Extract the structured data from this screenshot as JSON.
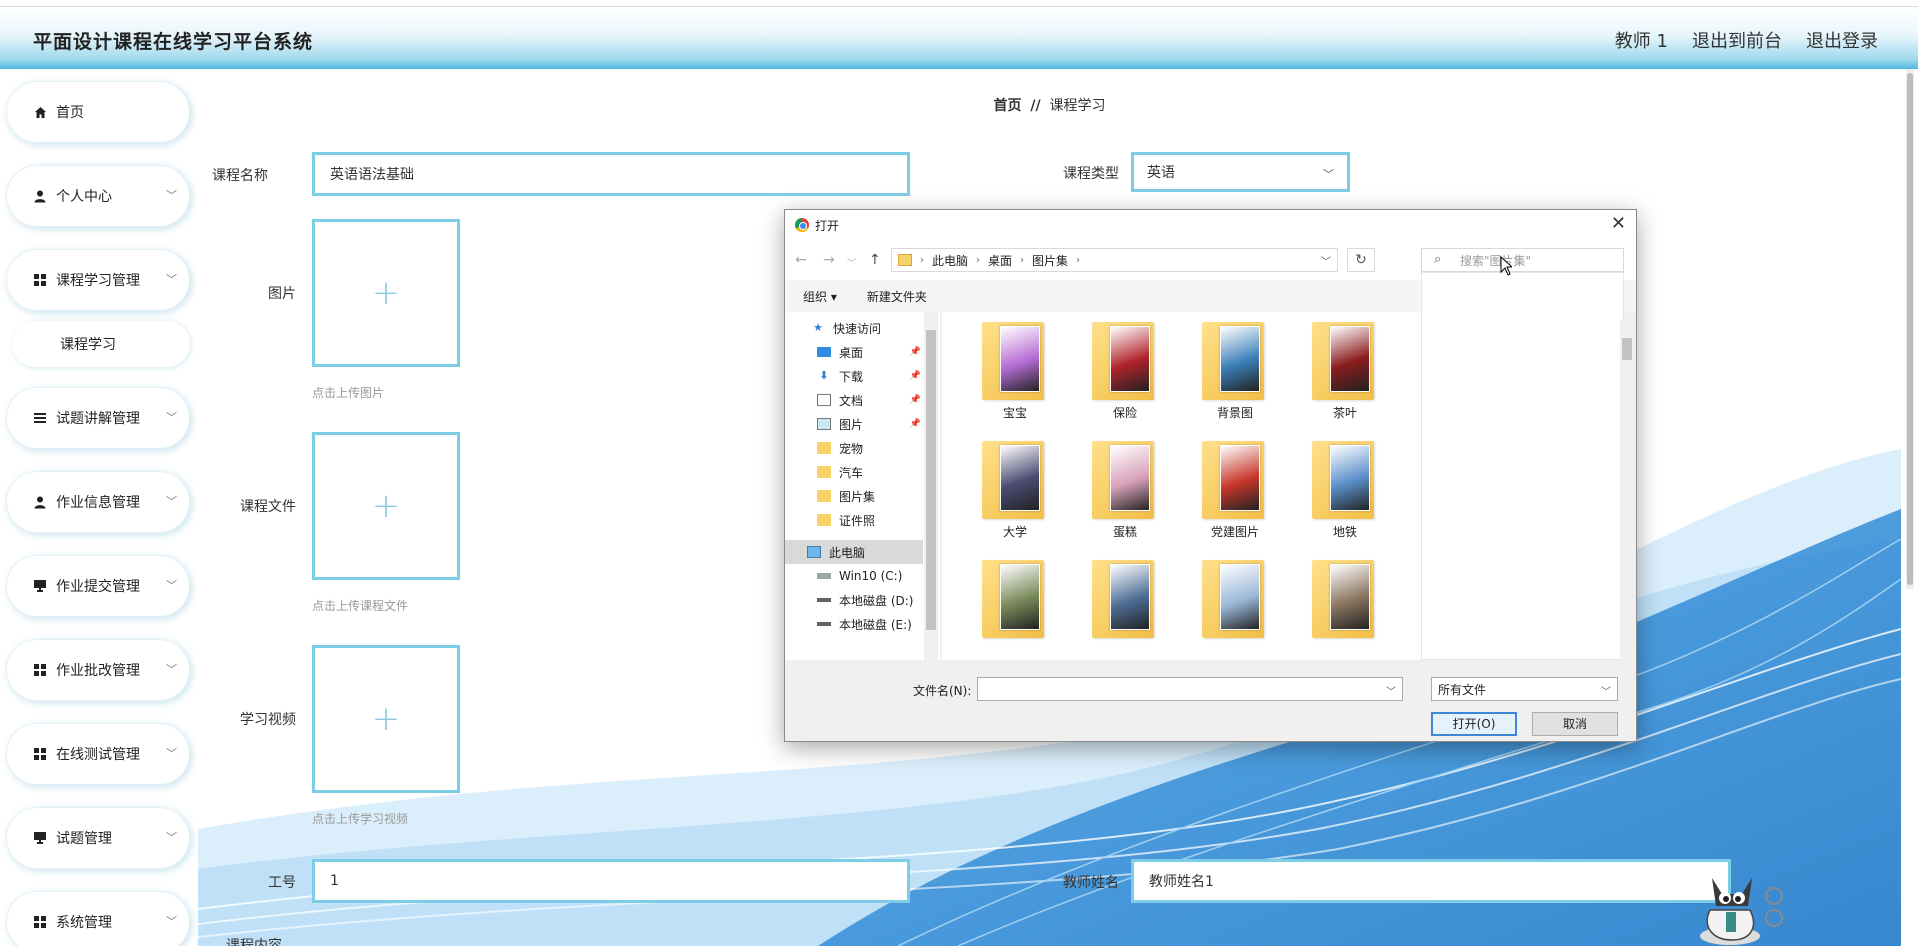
{
  "header": {
    "title": "平面设计课程在线学习平台系统",
    "user": "教师 1",
    "front_link": "退出到前台",
    "logout": "退出登录"
  },
  "sidebar": {
    "items": [
      {
        "label": "首页",
        "icon": "home-icon"
      },
      {
        "label": "个人中心",
        "icon": "person-icon"
      },
      {
        "label": "课程学习管理",
        "icon": "grid-icon"
      },
      {
        "label": "课程学习",
        "icon": ""
      },
      {
        "label": "试题讲解管理",
        "icon": "list-icon"
      },
      {
        "label": "作业信息管理",
        "icon": "person-icon"
      },
      {
        "label": "作业提交管理",
        "icon": "monitor-icon"
      },
      {
        "label": "作业批改管理",
        "icon": "grid-icon"
      },
      {
        "label": "在线测试管理",
        "icon": "grid-icon"
      },
      {
        "label": "试题管理",
        "icon": "monitor-icon"
      },
      {
        "label": "系统管理",
        "icon": "grid-icon"
      }
    ]
  },
  "breadcrumb": {
    "home": "首页",
    "sep": "//",
    "current": "课程学习"
  },
  "form": {
    "course_name_label": "课程名称",
    "course_name_value": "英语语法基础",
    "course_type_label": "课程类型",
    "course_type_value": "英语",
    "image_label": "图片",
    "image_hint": "点击上传图片",
    "file_label": "课程文件",
    "file_hint": "点击上传课程文件",
    "video_label": "学习视频",
    "video_hint": "点击上传学习视频",
    "job_no_label": "工号",
    "job_no_value": "1",
    "teacher_name_label": "教师姓名",
    "teacher_name_value": "教师姓名1",
    "content_label": "课程内容"
  },
  "dialog": {
    "title": "打开",
    "path": [
      "此电脑",
      "桌面",
      "图片集"
    ],
    "search_placeholder": "搜索\"图片集\"",
    "organize": "组织 ▾",
    "new_folder": "新建文件夹",
    "tree": [
      {
        "label": "快速访问",
        "icon": "star-icon",
        "pinned": false
      },
      {
        "label": "桌面",
        "icon": "desktop-icon",
        "pinned": true
      },
      {
        "label": "下载",
        "icon": "download-icon",
        "pinned": true
      },
      {
        "label": "文档",
        "icon": "document-icon",
        "pinned": true
      },
      {
        "label": "图片",
        "icon": "picture-icon",
        "pinned": true
      },
      {
        "label": "宠物",
        "icon": "folder-icon",
        "pinned": false
      },
      {
        "label": "汽车",
        "icon": "folder-icon",
        "pinned": false
      },
      {
        "label": "图片集",
        "icon": "folder-icon",
        "pinned": false
      },
      {
        "label": "证件照",
        "icon": "folder-icon",
        "pinned": false
      },
      {
        "label": "此电脑",
        "icon": "computer-icon",
        "pinned": false
      },
      {
        "label": "Win10 (C:)",
        "icon": "drive-icon",
        "pinned": false
      },
      {
        "label": "本地磁盘 (D:)",
        "icon": "drive-icon",
        "pinned": false
      },
      {
        "label": "本地磁盘 (E:)",
        "icon": "drive-icon",
        "pinned": false
      }
    ],
    "files": [
      {
        "label": "宝宝",
        "color": "#b66dd4"
      },
      {
        "label": "保险",
        "color": "#b0232a"
      },
      {
        "label": "背景图",
        "color": "#3c7fb8"
      },
      {
        "label": "茶叶",
        "color": "#8a1c1c"
      },
      {
        "label": "大学",
        "color": "#4b4b72"
      },
      {
        "label": "蛋糕",
        "color": "#d8a0b8"
      },
      {
        "label": "党建图片",
        "color": "#c8372b"
      },
      {
        "label": "地铁",
        "color": "#5a8fc9"
      },
      {
        "label": "",
        "color": "#7a8a5a"
      },
      {
        "label": "",
        "color": "#4e6e95"
      },
      {
        "label": "",
        "color": "#9bb8d8"
      },
      {
        "label": "",
        "color": "#8b7560"
      }
    ],
    "filename_label": "文件名(N):",
    "filename_value": "",
    "filetype_value": "所有文件",
    "open_button": "打开(O)",
    "cancel_button": "取消"
  }
}
